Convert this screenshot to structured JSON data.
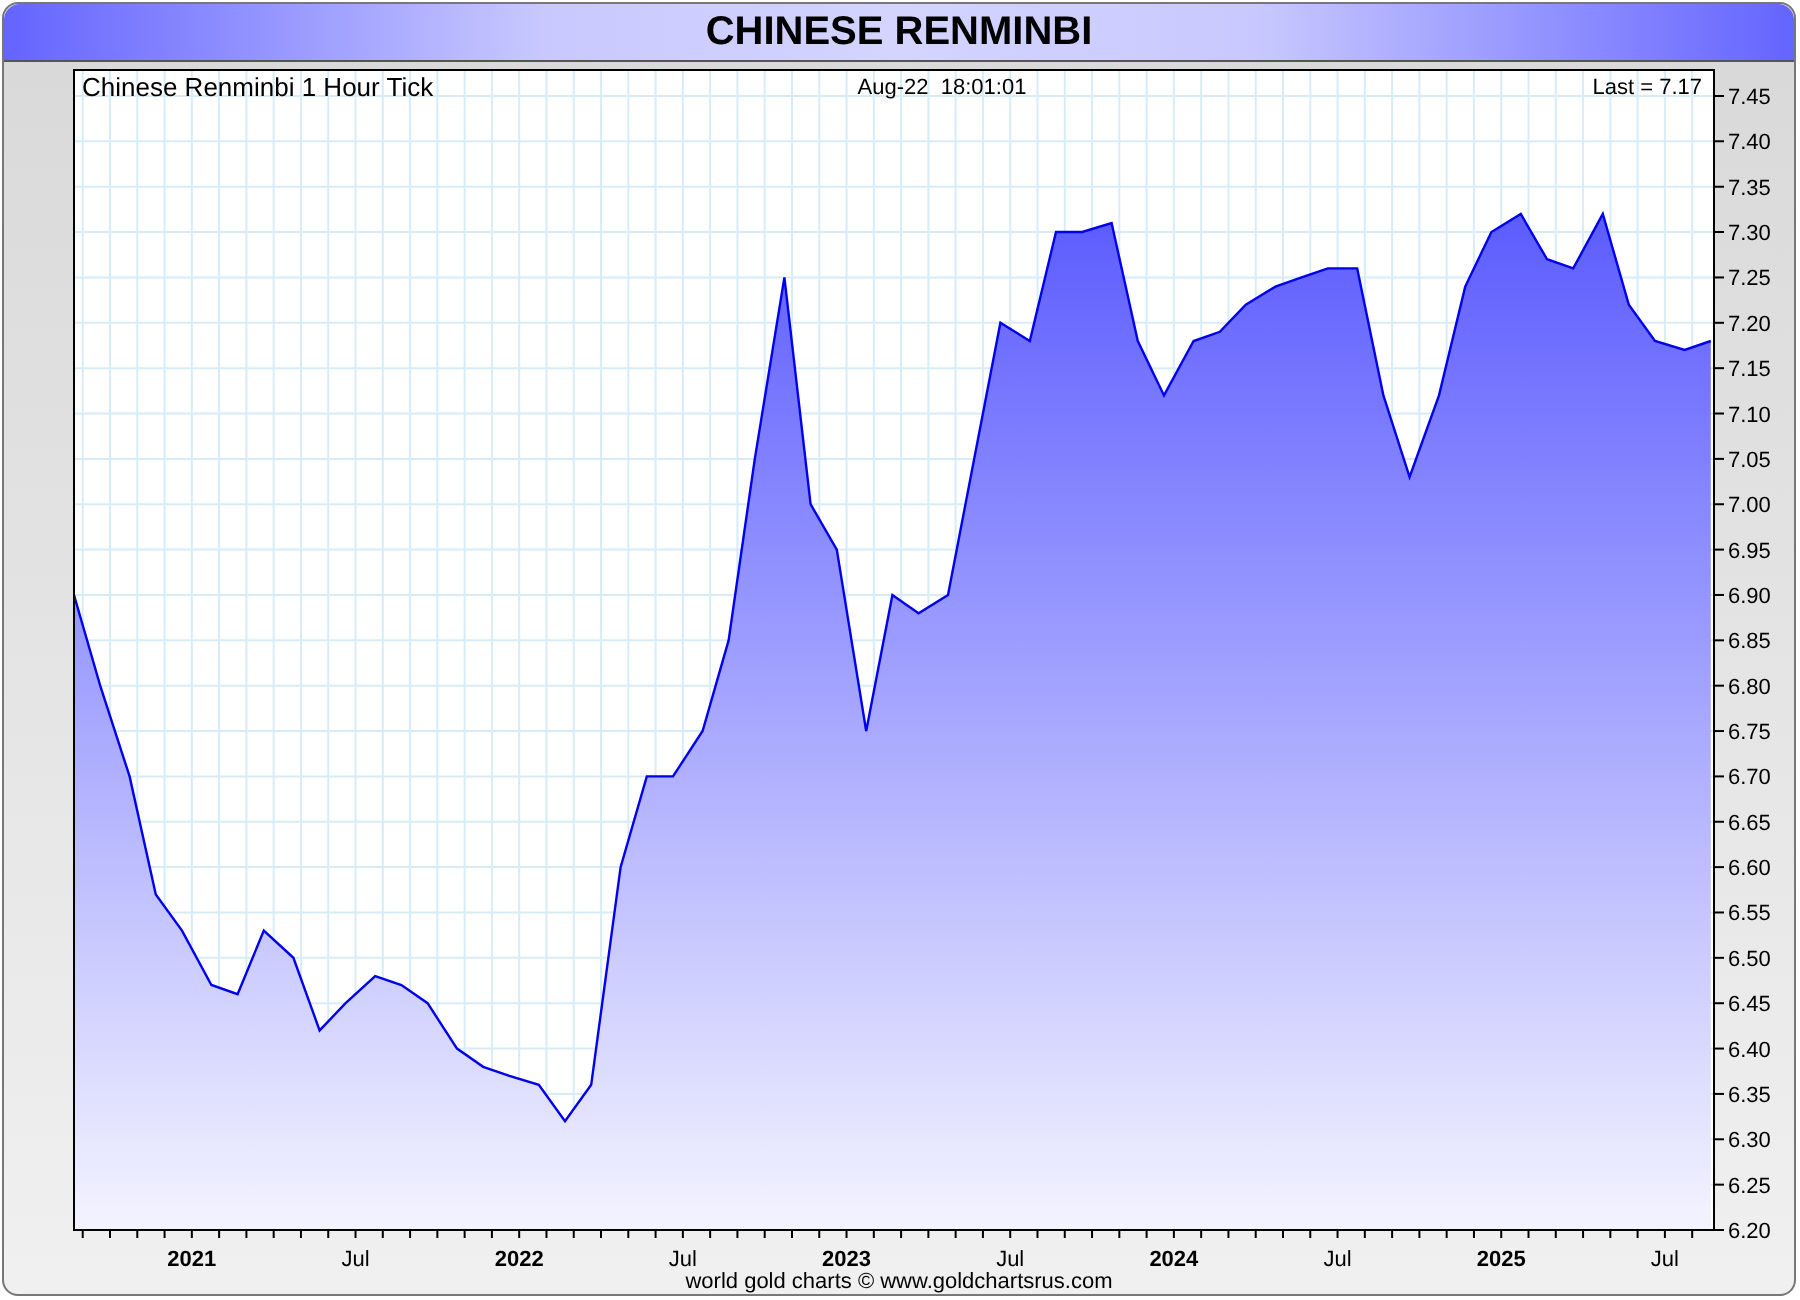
{
  "header": {
    "title": "CHINESE RENMINBI"
  },
  "chart": {
    "timestamp": "Aug-22  18:01:01",
    "last": "Last = 7.17",
    "chart_data": {
      "type": "area",
      "title": "Chinese Renminbi 1 Hour Tick",
      "x": [
        2020.64,
        2020.72,
        2020.81,
        2020.89,
        2020.97,
        2021.06,
        2021.14,
        2021.22,
        2021.31,
        2021.39,
        2021.47,
        2021.56,
        2021.64,
        2021.72,
        2021.81,
        2021.89,
        2021.97,
        2022.06,
        2022.14,
        2022.22,
        2022.31,
        2022.39,
        2022.47,
        2022.56,
        2022.64,
        2022.72,
        2022.81,
        2022.89,
        2022.97,
        2023.06,
        2023.14,
        2023.22,
        2023.31,
        2023.39,
        2023.47,
        2023.56,
        2023.64,
        2023.72,
        2023.81,
        2023.89,
        2023.97,
        2024.06,
        2024.14,
        2024.22,
        2024.31,
        2024.39,
        2024.47,
        2024.56,
        2024.64,
        2024.72,
        2024.81,
        2024.89,
        2024.97,
        2025.06,
        2025.14,
        2025.22,
        2025.31,
        2025.39,
        2025.47,
        2025.56,
        2025.64
      ],
      "grid": true,
      "series": [
        {
          "color": "#0000ee",
          "values": [
            6.9,
            6.8,
            6.7,
            6.57,
            6.53,
            6.47,
            6.46,
            6.53,
            6.5,
            6.42,
            6.45,
            6.48,
            6.47,
            6.45,
            6.4,
            6.38,
            6.37,
            6.36,
            6.32,
            6.36,
            6.6,
            6.7,
            6.7,
            6.75,
            6.85,
            7.05,
            7.25,
            7.0,
            6.95,
            6.75,
            6.9,
            6.88,
            6.9,
            7.05,
            7.2,
            7.18,
            7.3,
            7.3,
            7.31,
            7.18,
            7.12,
            7.18,
            7.19,
            7.22,
            7.24,
            7.25,
            7.26,
            7.26,
            7.12,
            7.03,
            7.12,
            7.24,
            7.3,
            7.32,
            7.27,
            7.26,
            7.32,
            7.22,
            7.18,
            7.17,
            7.18
          ]
        }
      ],
      "xlim": [
        2020.64,
        2025.65
      ],
      "ylim": [
        6.2,
        7.45
      ],
      "xticks": [
        {
          "value": 2021,
          "label": "2021"
        },
        {
          "value": 2021.5,
          "label": "Jul"
        },
        {
          "value": 2022,
          "label": "2022"
        },
        {
          "value": 2022.5,
          "label": "Jul"
        },
        {
          "value": 2023,
          "label": "2023"
        },
        {
          "value": 2023.5,
          "label": "Jul"
        },
        {
          "value": 2024,
          "label": "2024"
        },
        {
          "value": 2024.5,
          "label": "Jul"
        },
        {
          "value": 2025,
          "label": "2025"
        },
        {
          "value": 2025.5,
          "label": "Jul"
        }
      ],
      "yticks": [
        {
          "value": 7.45,
          "label": "7.45"
        },
        {
          "value": 7.4,
          "label": "7.40"
        },
        {
          "value": 7.35,
          "label": "7.35"
        },
        {
          "value": 7.3,
          "label": "7.30"
        },
        {
          "value": 7.25,
          "label": "7.25"
        },
        {
          "value": 7.2,
          "label": "7.20"
        },
        {
          "value": 7.15,
          "label": "7.15"
        },
        {
          "value": 7.1,
          "label": "7.10"
        },
        {
          "value": 7.05,
          "label": "7.05"
        },
        {
          "value": 7.0,
          "label": "7.00"
        },
        {
          "value": 6.95,
          "label": "6.95"
        },
        {
          "value": 6.9,
          "label": "6.90"
        },
        {
          "value": 6.85,
          "label": "6.85"
        },
        {
          "value": 6.8,
          "label": "6.80"
        },
        {
          "value": 6.75,
          "label": "6.75"
        },
        {
          "value": 6.7,
          "label": "6.70"
        },
        {
          "value": 6.65,
          "label": "6.65"
        },
        {
          "value": 6.6,
          "label": "6.60"
        },
        {
          "value": 6.55,
          "label": "6.55"
        },
        {
          "value": 6.5,
          "label": "6.50"
        },
        {
          "value": 6.45,
          "label": "6.45"
        },
        {
          "value": 6.4,
          "label": "6.40"
        },
        {
          "value": 6.35,
          "label": "6.35"
        },
        {
          "value": 6.3,
          "label": "6.30"
        },
        {
          "value": 6.25,
          "label": "6.25"
        },
        {
          "value": 6.2,
          "label": "6.20"
        }
      ]
    }
  },
  "footer": "world gold charts © www.goldchartsrus.com"
}
